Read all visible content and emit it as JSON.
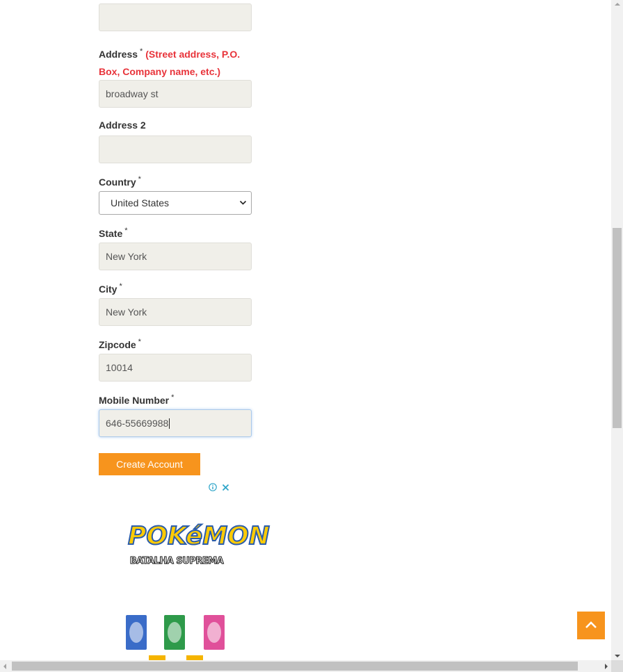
{
  "form": {
    "top_field": {
      "value": ""
    },
    "address": {
      "label": "Address",
      "required": "*",
      "note_line1": "(Street address, P.O.",
      "note_line2": "Box, Company name, etc.)",
      "value": "broadway st"
    },
    "address2": {
      "label": "Address 2",
      "value": ""
    },
    "country": {
      "label": "Country",
      "required": "*",
      "selected": "United States"
    },
    "state": {
      "label": "State",
      "required": "*",
      "value": "New York"
    },
    "city": {
      "label": "City",
      "required": "*",
      "value": "New York"
    },
    "zipcode": {
      "label": "Zipcode",
      "required": "*",
      "value": "10014"
    },
    "mobile": {
      "label": "Mobile Number",
      "required": "*",
      "value": "646-55669988"
    },
    "submit_label": "Create Account"
  },
  "ad": {
    "adchoices_icon": "info-icon",
    "close_icon": "close-icon",
    "brand": "POKéMON",
    "subtitle": "BATALHA SUPREMA"
  },
  "colors": {
    "accent": "#f7941d",
    "note_red": "#e8333a",
    "input_bg": "#f0efe9"
  }
}
